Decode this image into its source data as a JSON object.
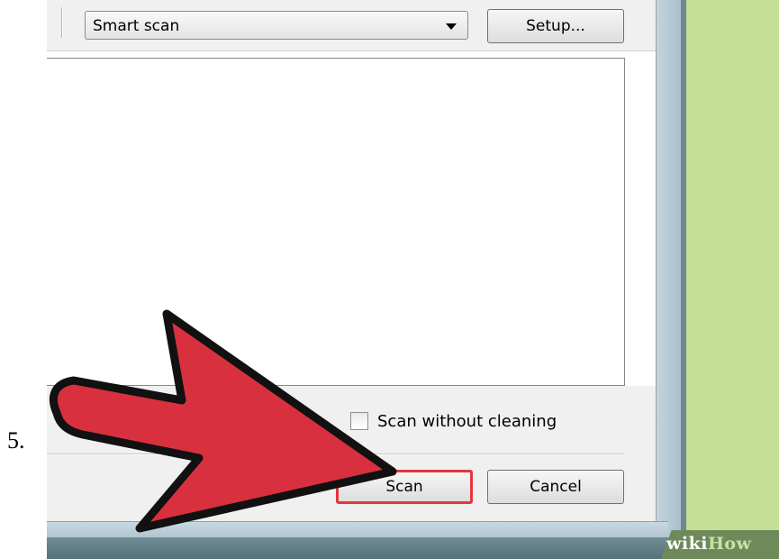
{
  "step": {
    "number": "5."
  },
  "toolbar": {
    "select_value": "Smart scan",
    "setup_label": "Setup..."
  },
  "options": {
    "scan_without_cleaning_label": "Scan without cleaning",
    "scan_without_cleaning_checked": false
  },
  "actions": {
    "scan_label": "Scan",
    "cancel_label": "Cancel"
  },
  "branding": {
    "wiki": "wiki",
    "how": "How"
  },
  "colors": {
    "highlight": "#e3373c",
    "arrow": "#d9303f",
    "background": "#c5df96"
  }
}
